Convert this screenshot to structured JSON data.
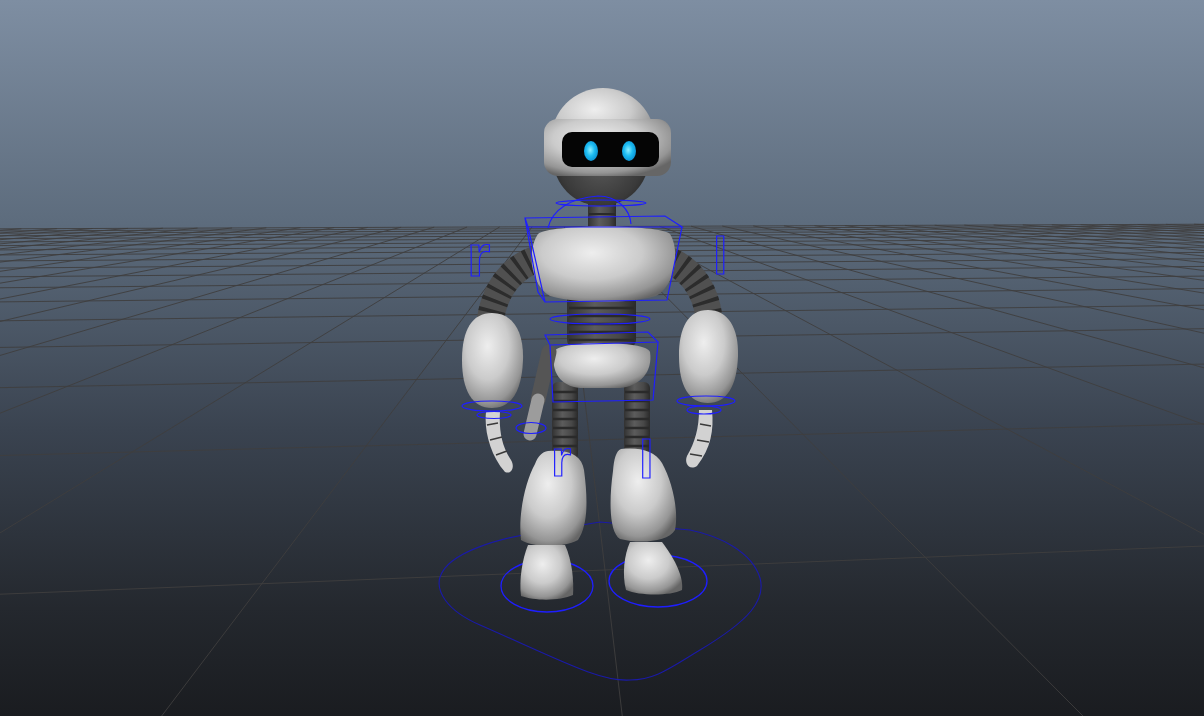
{
  "viewport": {
    "show_grid": true
  },
  "rig_controls": {
    "shown": true,
    "pole_labels": [
      "r",
      "l",
      "r",
      "l"
    ]
  }
}
